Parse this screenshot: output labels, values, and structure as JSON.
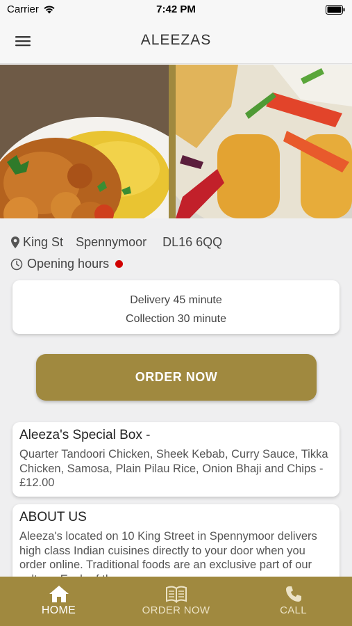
{
  "status_bar": {
    "carrier": "Carrier",
    "time": "7:42 PM"
  },
  "header": {
    "title": "ALEEZAS"
  },
  "location": {
    "street": "King St",
    "town": "Spennymoor",
    "postcode": "DL16 6QQ",
    "opening_hours_label": "Opening hours",
    "status_color": "#d10000"
  },
  "service_times": {
    "delivery": "Delivery 45 minute",
    "collection": "Collection 30 minute"
  },
  "order_button": {
    "label": "ORDER NOW"
  },
  "special": {
    "title": "Aleeza's Special Box -",
    "description": "Quarter Tandoori Chicken, Sheek Kebab, Curry Sauce, Tikka Chicken, Samosa, Plain Pilau Rice, Onion Bhaji and Chips - £12.00"
  },
  "about": {
    "title": "ABOUT US",
    "text": "Aleeza's located on 10 King Street in Spennymoor delivers high class Indian cuisines directly to your door when you order online. Traditional foods are an exclusive part of our culture. Each of the m"
  },
  "tabs": [
    {
      "label": "HOME",
      "icon": "home-icon"
    },
    {
      "label": "ORDER NOW",
      "icon": "menu-book-icon"
    },
    {
      "label": "CALL",
      "icon": "phone-icon"
    }
  ],
  "colors": {
    "brand": "#a0893f",
    "background": "#efeff0"
  }
}
